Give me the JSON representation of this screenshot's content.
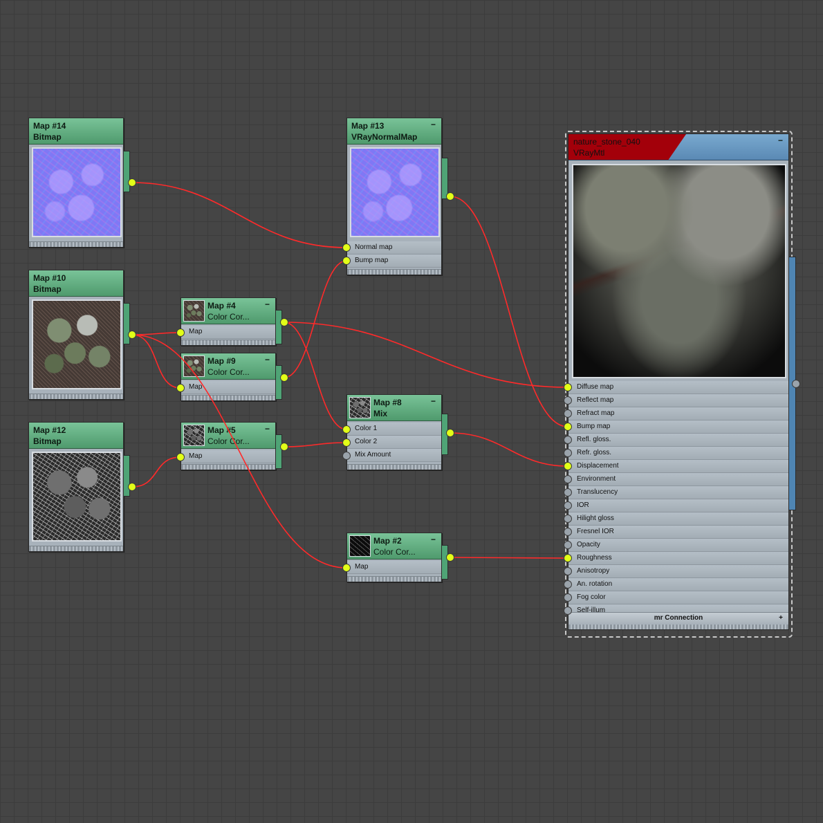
{
  "nodes": {
    "map14": {
      "title": "Map #14",
      "type": "Bitmap"
    },
    "map10": {
      "title": "Map #10",
      "type": "Bitmap"
    },
    "map12": {
      "title": "Map #12",
      "type": "Bitmap"
    },
    "map13": {
      "title": "Map #13",
      "type": "VRayNormalMap",
      "slots": [
        "Normal map",
        "Bump map"
      ]
    },
    "map4": {
      "title": "Map #4",
      "type": "Color Cor...",
      "slots": [
        "Map"
      ]
    },
    "map9": {
      "title": "Map #9",
      "type": "Color Cor...",
      "slots": [
        "Map"
      ]
    },
    "map5": {
      "title": "Map #5",
      "type": "Color Cor...",
      "slots": [
        "Map"
      ]
    },
    "map8": {
      "title": "Map #8",
      "type": "Mix",
      "slots": [
        "Color 1",
        "Color 2",
        "Mix Amount"
      ]
    },
    "map2": {
      "title": "Map #2",
      "type": "Color Cor...",
      "slots": [
        "Map"
      ]
    }
  },
  "material": {
    "name": "nature_stone_040",
    "type": "VRayMtl",
    "slots": [
      "Diffuse map",
      "Reflect map",
      "Refract map",
      "Bump map",
      "Refl. gloss.",
      "Refr. gloss.",
      "Displacement",
      "Environment",
      "Translucency",
      "IOR",
      "Hilight gloss",
      "Fresnel IOR",
      "Opacity",
      "Roughness",
      "Anisotropy",
      "An. rotation",
      "Fog color",
      "Self-illum"
    ],
    "connected_slots": [
      "Diffuse map",
      "Bump map",
      "Displacement",
      "Roughness"
    ],
    "footer": "mr Connection",
    "footer_icon": "plus-icon"
  },
  "minimize_symbol": "−",
  "plus_symbol": "+",
  "colors": {
    "background": "#454545",
    "node_header": "#5fae80",
    "material_header": "#6a99c4",
    "material_name_bg": "#a3000a",
    "wire": "#ff2a2a",
    "port_connected": "#e2ff18",
    "port_empty": "#9aa3ab"
  }
}
